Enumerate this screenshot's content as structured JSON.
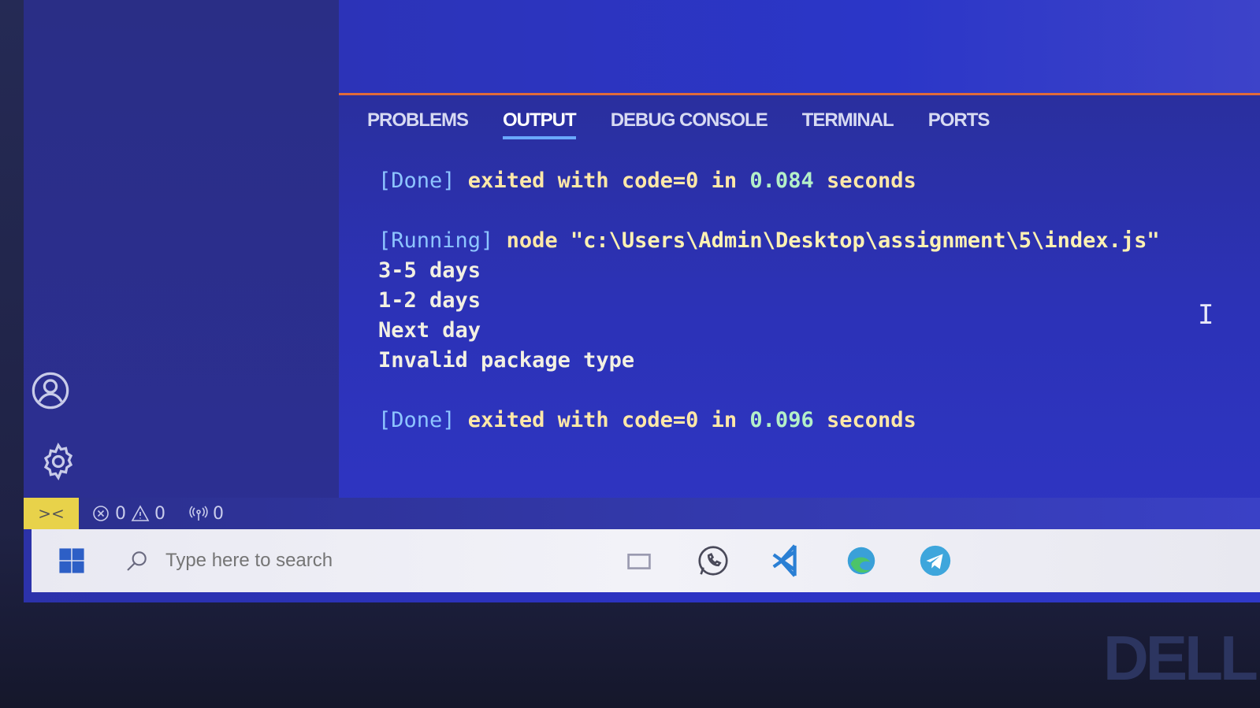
{
  "panel": {
    "tabs": [
      {
        "label": "PROBLEMS",
        "active": false
      },
      {
        "label": "OUTPUT",
        "active": true
      },
      {
        "label": "DEBUG CONSOLE",
        "active": false
      },
      {
        "label": "TERMINAL",
        "active": false
      },
      {
        "label": "PORTS",
        "active": false
      }
    ],
    "output": {
      "done1_tag": "[Done]",
      "done1_text": " exited with code=0 in ",
      "done1_time": "0.084",
      "done1_unit": " seconds",
      "running_tag": "[Running]",
      "running_cmd": " node ",
      "running_path": "\"c:\\Users\\Admin\\Desktop\\assignment\\5\\index.js\"",
      "lines": [
        "3-5 days",
        "1-2 days",
        "Next day",
        "Invalid package type"
      ],
      "done2_tag": "[Done]",
      "done2_text": " exited with code=0 in ",
      "done2_time": "0.096",
      "done2_unit": " seconds"
    }
  },
  "statusbar": {
    "errors": "0",
    "warnings": "0",
    "ports": "0"
  },
  "taskbar": {
    "search_placeholder": "Type here to search"
  },
  "brand": "DELL",
  "colors": {
    "accent_border": "#e06a3a",
    "active_tab_underline": "#6aa8ff",
    "remote_indicator": "#e8d24a"
  }
}
